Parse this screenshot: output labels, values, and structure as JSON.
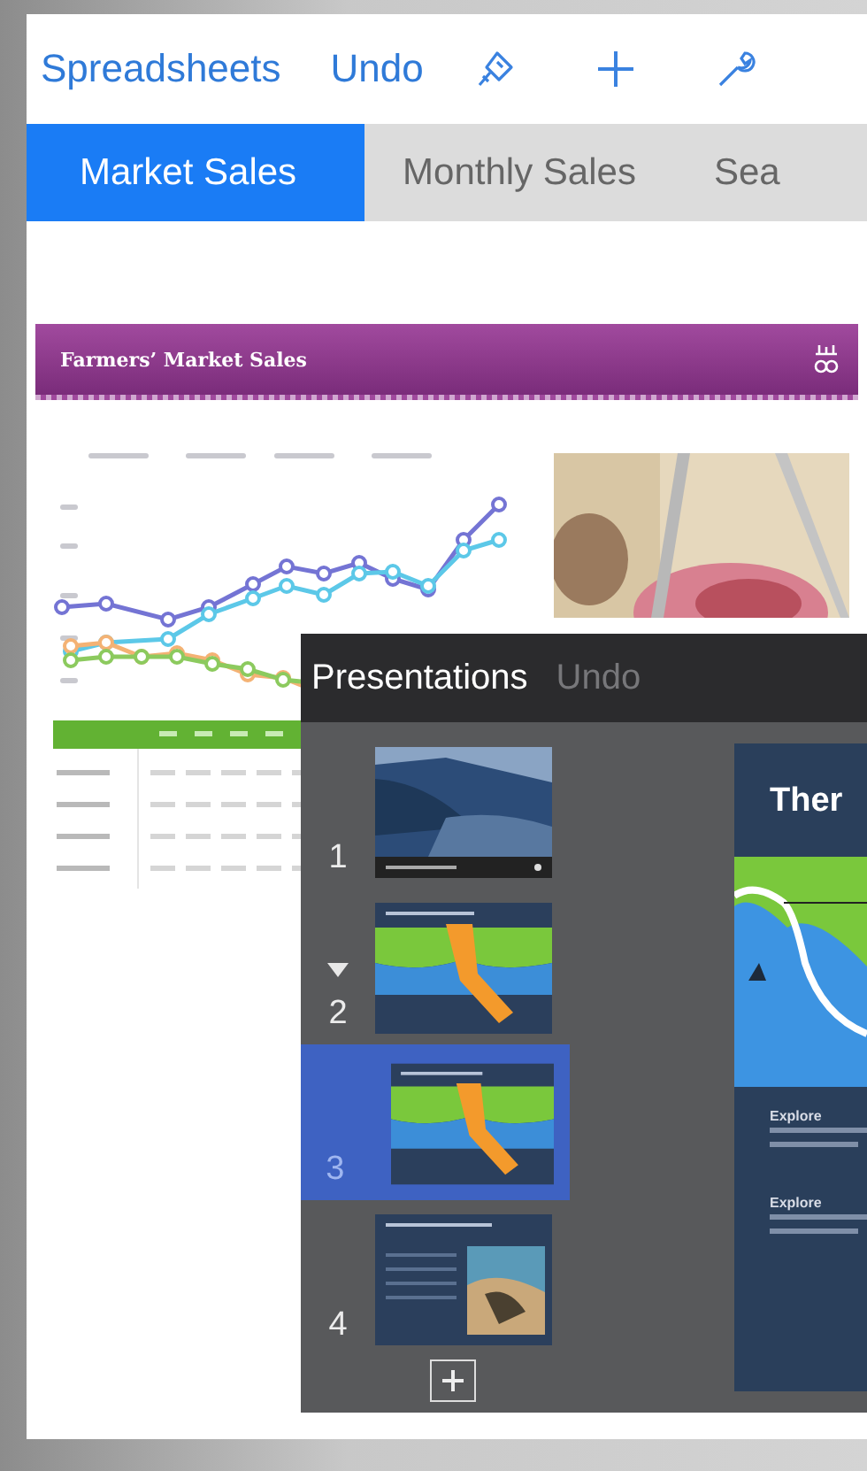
{
  "numbers": {
    "toolbar": {
      "back": "Spreadsheets",
      "undo": "Undo"
    },
    "sheet_tabs": [
      {
        "label": "Market Sales",
        "selected": true
      },
      {
        "label": "Monthly Sales",
        "selected": false
      },
      {
        "label": "Sea",
        "selected": false
      }
    ],
    "banner": {
      "title": "Farmers’ Market Sales"
    }
  },
  "keynote": {
    "toolbar": {
      "back": "Presentations",
      "undo": "Undo",
      "undo_disabled": true
    },
    "slides": [
      {
        "number": "1",
        "selected": false,
        "collapse_arrow": false
      },
      {
        "number": "2",
        "kind": "map",
        "selected": false,
        "collapse_arrow": true
      },
      {
        "number": "3",
        "kind": "map",
        "selected": true,
        "collapse_arrow": false
      },
      {
        "number": "4",
        "kind": "photo-text",
        "selected": false,
        "collapse_arrow": false
      }
    ],
    "current_slide": {
      "title": "Ther",
      "headings": [
        "Explore",
        "Explore"
      ]
    }
  }
}
